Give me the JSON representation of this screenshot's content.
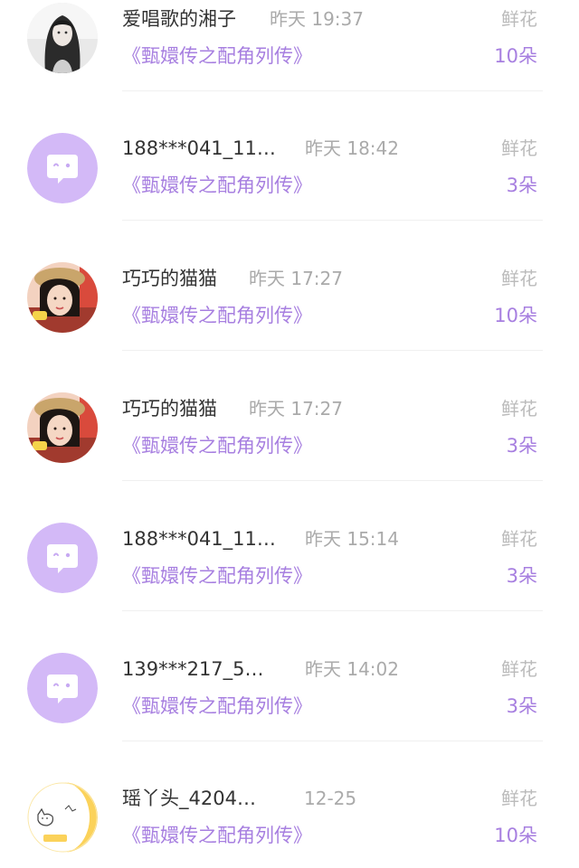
{
  "gifts": [
    {
      "avatar": "portrait-photo",
      "name": "爱唱歌的湘子",
      "time": "昨天 19:37",
      "book": "《甄嬛传之配角列传》",
      "gift_label": "鲜花",
      "gift_count": "10朵"
    },
    {
      "avatar": "default-chat-avatar",
      "name": "188***041_11…",
      "time": "昨天 18:42",
      "book": "《甄嬛传之配角列传》",
      "gift_label": "鲜花",
      "gift_count": "3朵"
    },
    {
      "avatar": "girl-straw-hat-photo",
      "name": "巧巧的猫猫",
      "time": "昨天 17:27",
      "book": "《甄嬛传之配角列传》",
      "gift_label": "鲜花",
      "gift_count": "10朵"
    },
    {
      "avatar": "girl-straw-hat-photo",
      "name": "巧巧的猫猫",
      "time": "昨天 17:27",
      "book": "《甄嬛传之配角列传》",
      "gift_label": "鲜花",
      "gift_count": "3朵"
    },
    {
      "avatar": "default-chat-avatar",
      "name": "188***041_11…",
      "time": "昨天 15:14",
      "book": "《甄嬛传之配角列传》",
      "gift_label": "鲜花",
      "gift_count": "3朵"
    },
    {
      "avatar": "default-chat-avatar",
      "name": "139***217_5…",
      "time": "昨天 14:02",
      "book": "《甄嬛传之配角列传》",
      "gift_label": "鲜花",
      "gift_count": "3朵"
    },
    {
      "avatar": "yellow-moon-cat-avatar",
      "name": "瑶丫头_4204…",
      "time": "12-25",
      "book": "《甄嬛传之配角列传》",
      "gift_label": "鲜花",
      "gift_count": "10朵"
    }
  ],
  "colors": {
    "accent": "#a77fe0",
    "name_text": "#333333",
    "meta_text": "#aaaaaa",
    "default_avatar_bg": "#d3b9f7",
    "moon_yellow": "#fbd25a"
  }
}
